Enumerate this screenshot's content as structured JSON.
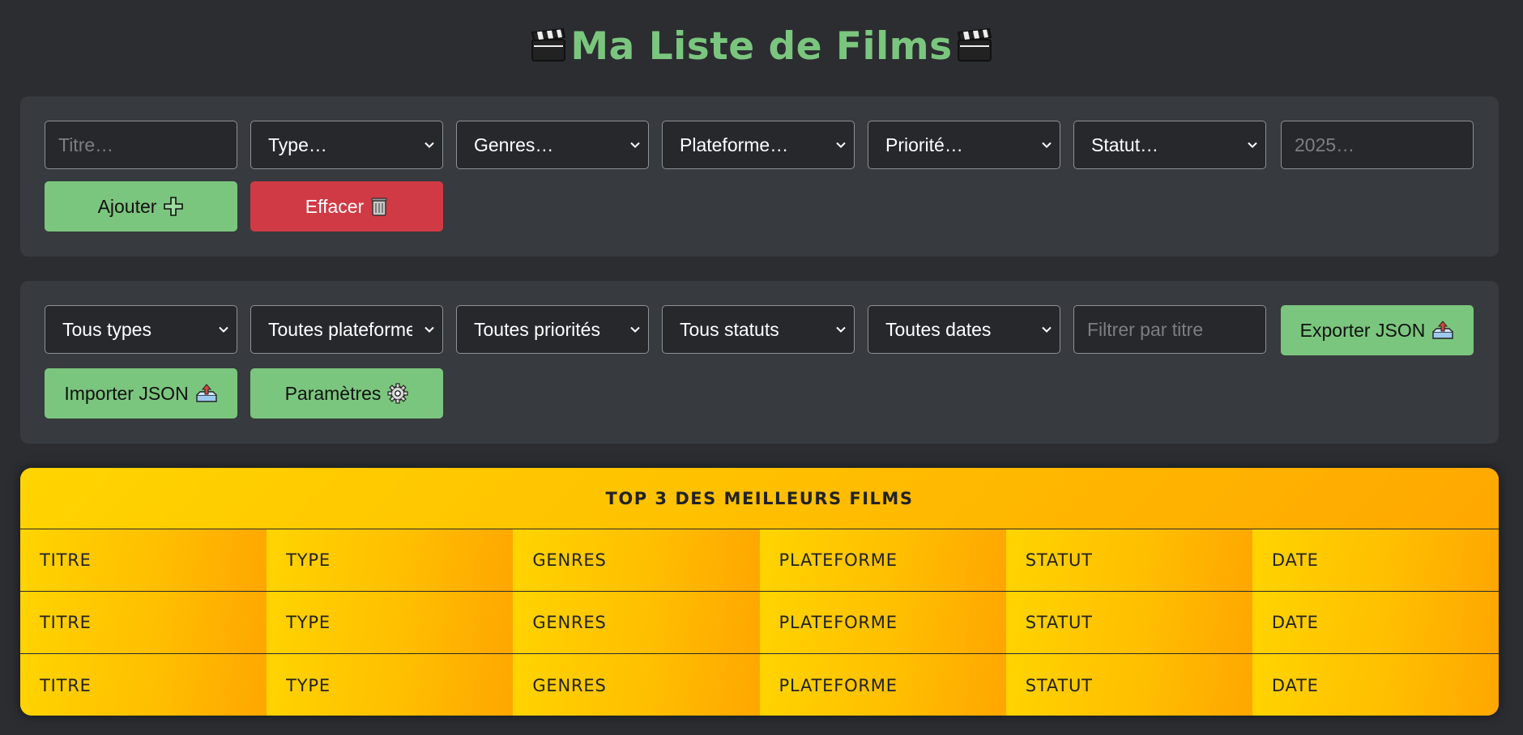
{
  "app": {
    "title": "Ma Liste de Films"
  },
  "add_form": {
    "title_placeholder": "Titre…",
    "type_select": "Type…",
    "genres_select": "Genres…",
    "platform_select": "Plateforme…",
    "priority_select": "Priorité…",
    "status_select": "Statut…",
    "date_placeholder": "2025…",
    "add_button": "Ajouter",
    "clear_button": "Effacer"
  },
  "filters": {
    "type_filter": "Tous types",
    "platform_filter": "Toutes plateformes",
    "priority_filter": "Toutes priorités",
    "status_filter": "Tous statuts",
    "date_filter": "Toutes dates",
    "title_filter_placeholder": "Filtrer par titre",
    "export_button": "Exporter JSON",
    "import_button": "Importer JSON",
    "settings_button": "Paramètres"
  },
  "top3": {
    "heading": "TOP 3 DES MEILLEURS FILMS",
    "rows": [
      [
        "TITRE",
        "TYPE",
        "GENRES",
        "PLATEFORME",
        "STATUT",
        "DATE"
      ],
      [
        "TITRE",
        "TYPE",
        "GENRES",
        "PLATEFORME",
        "STATUT",
        "DATE"
      ],
      [
        "TITRE",
        "TYPE",
        "GENRES",
        "PLATEFORME",
        "STATUT",
        "DATE"
      ]
    ]
  },
  "icons": {
    "title_left": "clapperboard-icon",
    "title_right": "clapperboard-icon",
    "add": "plus-icon",
    "clear": "trash-icon",
    "export": "outbox-icon",
    "import": "outbox-icon",
    "settings": "gear-icon"
  },
  "colors": {
    "background": "#2b2d31",
    "panel": "#373a3e",
    "accent_green": "#7bc67e",
    "danger_red": "#d03a44",
    "gold": "#ffc400"
  }
}
